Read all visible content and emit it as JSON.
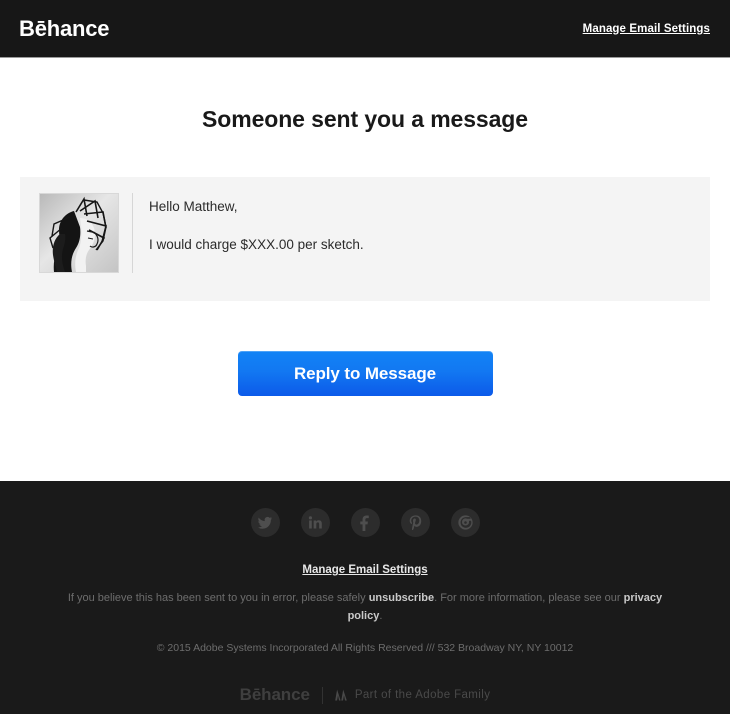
{
  "header": {
    "brand": "Bēhance",
    "manage_link": "Manage Email Settings"
  },
  "main": {
    "headline": "Someone sent you a message",
    "message": {
      "avatar_alt": "sender-avatar",
      "greeting": "Hello Matthew,",
      "body": "I would charge $XXX.00 per sketch."
    },
    "cta_label": "Reply to Message"
  },
  "footer": {
    "social": [
      {
        "name": "twitter-icon",
        "label": "Twitter"
      },
      {
        "name": "linkedin-icon",
        "label": "LinkedIn"
      },
      {
        "name": "facebook-icon",
        "label": "Facebook"
      },
      {
        "name": "pinterest-icon",
        "label": "Pinterest"
      },
      {
        "name": "instagram-icon",
        "label": "Instagram"
      }
    ],
    "manage_link": "Manage Email Settings",
    "note_part1": "If you believe this has been sent to you in error, please safely ",
    "note_unsubscribe": "unsubscribe",
    "note_part2": ". For more information, please see our ",
    "note_privacy": "privacy policy",
    "note_part3": ".",
    "copyright": "© 2015 Adobe Systems Incorporated All Rights Reserved /// 532 Broadway NY, NY 10012",
    "brand": "Bēhance",
    "adobe_family": "Part of the Adobe Family"
  },
  "colors": {
    "header_bg": "#171717",
    "footer_bg": "#1a1a1a",
    "card_bg": "#f4f4f4",
    "cta_blue_top": "#1283f5",
    "cta_blue_bottom": "#0c5ae9"
  }
}
